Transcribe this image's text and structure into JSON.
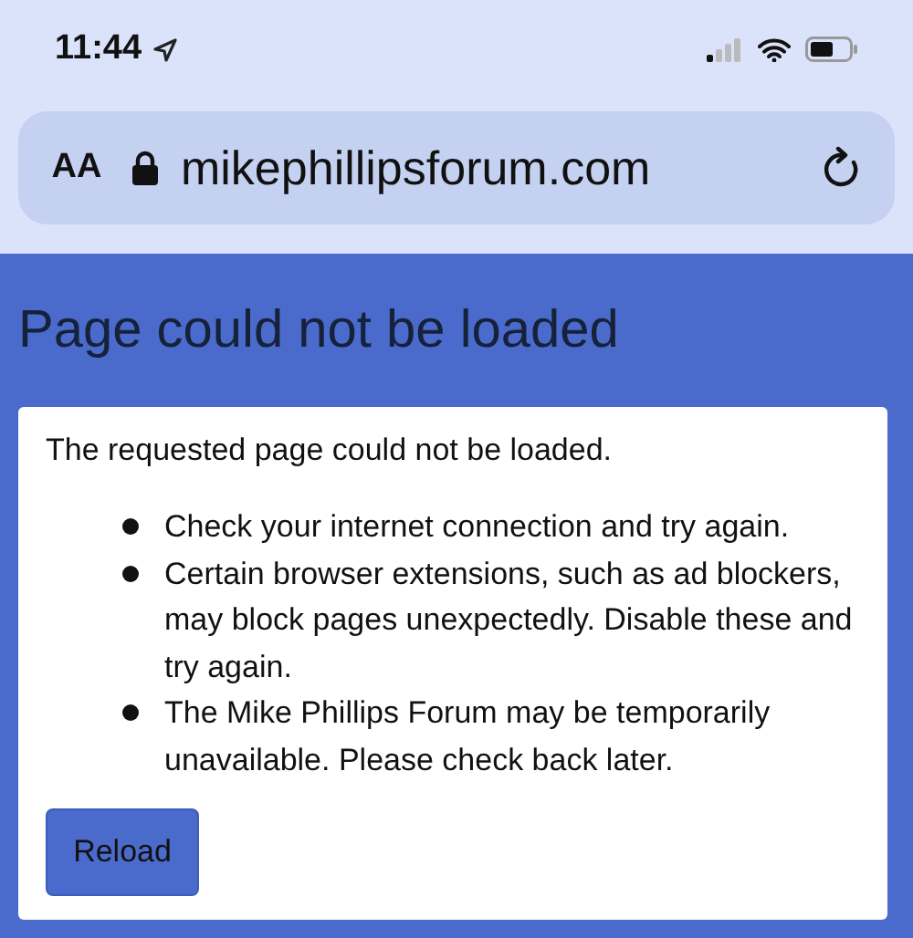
{
  "status_bar": {
    "time": "11:44"
  },
  "address_bar": {
    "text_size_label": "AA",
    "url": "mikephillipsforum.com"
  },
  "page": {
    "heading": "Page could not be loaded",
    "message": "The requested page could not be loaded.",
    "reasons": [
      "Check your internet connection and try again.",
      "Certain browser extensions, such as ad blockers, may block pages unexpectedly. Disable these and try again.",
      "The Mike Phillips Forum may be temporarily unavailable. Please check back later."
    ],
    "button": "Reload"
  }
}
